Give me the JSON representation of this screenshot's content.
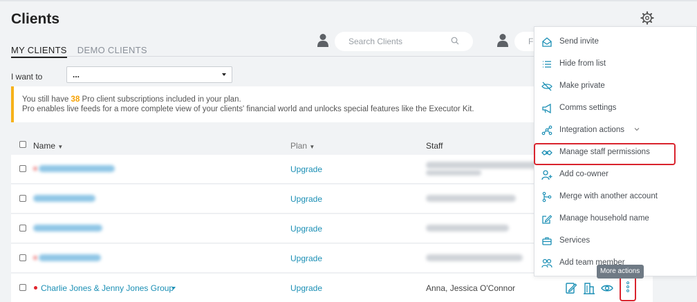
{
  "page": {
    "title": "Clients"
  },
  "tabs": [
    {
      "label": "MY CLIENTS",
      "active": true
    },
    {
      "label": "DEMO CLIENTS",
      "active": false
    }
  ],
  "search": {
    "placeholder": "Search Clients"
  },
  "filter": {
    "placeholder": "Fi"
  },
  "want": {
    "label": "I want to",
    "value": "..."
  },
  "banner": {
    "line1_before": "You still have ",
    "count": "38",
    "line1_after": " Pro client subscriptions included in your plan.",
    "line2": "Pro enables live feeds for a more complete view of your clients' financial world and unlocks special features like the Executor Kit."
  },
  "table": {
    "headers": {
      "name": "Name",
      "plan": "Plan",
      "staff": "Staff"
    },
    "rows": [
      {
        "plan": "Upgrade"
      },
      {
        "plan": "Upgrade"
      },
      {
        "plan": "Upgrade"
      },
      {
        "plan": "Upgrade"
      },
      {
        "name": "Charlie Jones & Jenny Jones Group",
        "plan": "Upgrade",
        "staff": "Anna, Jessica O'Connor"
      }
    ]
  },
  "menu": {
    "items": [
      {
        "label": "Send invite",
        "icon": "envelope-open-icon"
      },
      {
        "label": "Hide from list",
        "icon": "list-icon"
      },
      {
        "label": "Make private",
        "icon": "eye-slash-icon"
      },
      {
        "label": "Comms settings",
        "icon": "megaphone-icon"
      },
      {
        "label": "Integration actions",
        "icon": "share-nodes-icon"
      },
      {
        "label": "Manage staff permissions",
        "icon": "staff-handshake-icon"
      },
      {
        "label": "Add co-owner",
        "icon": "user-plus-icon"
      },
      {
        "label": "Merge with another account",
        "icon": "merge-icon"
      },
      {
        "label": "Manage household name",
        "icon": "edit-icon"
      },
      {
        "label": "Services",
        "icon": "briefcase-icon"
      },
      {
        "label": "Add team member",
        "icon": "users-icon"
      }
    ]
  },
  "tooltip": {
    "text": "More actions"
  },
  "colors": {
    "accent": "#1b8fb5",
    "highlight": "#d9232d",
    "banner": "#f6b21a"
  }
}
